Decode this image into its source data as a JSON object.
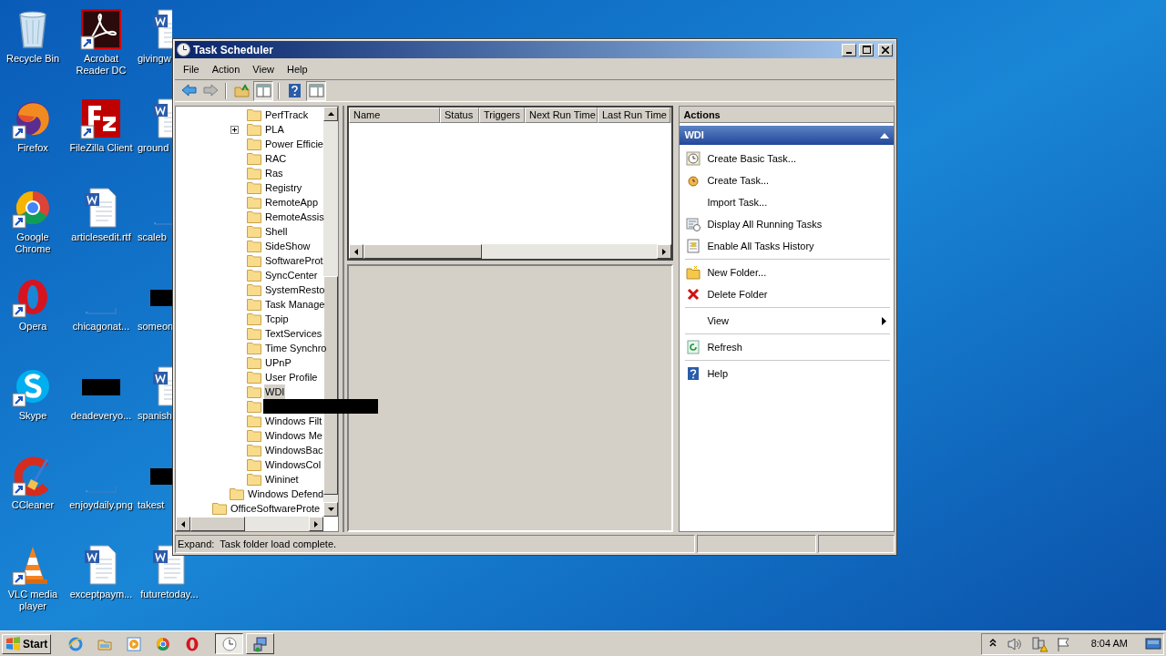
{
  "desktop": {
    "icons": [
      {
        "label": "Recycle Bin",
        "kind": "recycle",
        "shortcut": false
      },
      {
        "label": "Firefox",
        "kind": "firefox",
        "shortcut": true
      },
      {
        "label": "Google Chrome",
        "kind": "chrome",
        "shortcut": true
      },
      {
        "label": "Opera",
        "kind": "opera",
        "shortcut": true
      },
      {
        "label": "Skype",
        "kind": "skype",
        "shortcut": true
      },
      {
        "label": "CCleaner",
        "kind": "ccleaner",
        "shortcut": true
      },
      {
        "label": "VLC media player",
        "kind": "vlc",
        "shortcut": true
      },
      {
        "label": "Acrobat Reader DC",
        "kind": "acrobat",
        "shortcut": true
      },
      {
        "label": "FileZilla Client",
        "kind": "filezilla",
        "shortcut": true
      },
      {
        "label": "articlesedit.rtf",
        "kind": "word",
        "shortcut": false
      },
      {
        "label": "chicagonat...",
        "kind": "thumbnail",
        "shortcut": false
      },
      {
        "label": "deadeveryo...",
        "kind": "redacted",
        "shortcut": false
      },
      {
        "label": "enjoydaily.png",
        "kind": "thumbnail",
        "shortcut": false
      },
      {
        "label": "exceptpaym...",
        "kind": "word",
        "shortcut": false
      },
      {
        "label": "givingw",
        "kind": "word",
        "shortcut": false
      },
      {
        "label": "ground",
        "kind": "word",
        "shortcut": false
      },
      {
        "label": "scaleb",
        "kind": "thumbnail",
        "shortcut": false
      },
      {
        "label": "someon",
        "kind": "redacted",
        "shortcut": false
      },
      {
        "label": "spanish",
        "kind": "word",
        "shortcut": false
      },
      {
        "label": "takest",
        "kind": "redacted",
        "shortcut": false
      },
      {
        "label": "futuretoday...",
        "kind": "word",
        "shortcut": false
      }
    ]
  },
  "window": {
    "title": "Task Scheduler",
    "menu": [
      "File",
      "Action",
      "View",
      "Help"
    ],
    "toolbar": [
      {
        "kind": "back",
        "pressed": false
      },
      {
        "kind": "forward",
        "pressed": false
      },
      {
        "kind": "separator"
      },
      {
        "kind": "up-folder",
        "pressed": false
      },
      {
        "kind": "tree-pane",
        "pressed": true
      },
      {
        "kind": "separator"
      },
      {
        "kind": "help",
        "pressed": false
      },
      {
        "kind": "action-pane",
        "pressed": true
      }
    ],
    "tree": [
      {
        "children": [
          {
            "children": [
              {
                "label": "PerfTrack",
                "expandable": false,
                "selected": false
              },
              {
                "label": "PLA",
                "expandable": true,
                "selected": false
              },
              {
                "label": "Power Efficie",
                "expandable": false,
                "selected": false
              },
              {
                "label": "RAC",
                "expandable": false,
                "selected": false
              },
              {
                "label": "Ras",
                "expandable": false,
                "selected": false
              },
              {
                "label": "Registry",
                "expandable": false,
                "selected": false
              },
              {
                "label": "RemoteApp",
                "expandable": false,
                "selected": false
              },
              {
                "label": "RemoteAssis",
                "expandable": false,
                "selected": false
              },
              {
                "label": "Shell",
                "expandable": false,
                "selected": false
              },
              {
                "label": "SideShow",
                "expandable": false,
                "selected": false
              },
              {
                "label": "SoftwareProt",
                "expandable": false,
                "selected": false
              },
              {
                "label": "SyncCenter",
                "expandable": false,
                "selected": false
              },
              {
                "label": "SystemResto",
                "expandable": false,
                "selected": false
              },
              {
                "label": "Task Manage",
                "expandable": false,
                "selected": false
              },
              {
                "label": "Tcpip",
                "expandable": false,
                "selected": false
              },
              {
                "label": "TextServices",
                "expandable": false,
                "selected": false
              },
              {
                "label": "Time Synchro",
                "expandable": false,
                "selected": false
              },
              {
                "label": "UPnP",
                "expandable": false,
                "selected": false
              },
              {
                "label": "User Profile",
                "expandable": false,
                "selected": false
              },
              {
                "label": "WDI",
                "expandable": false,
                "selected": true
              },
              {
                "redacted": true,
                "expandable": false
              },
              {
                "label": "Windows Filt",
                "expandable": false,
                "selected": false
              },
              {
                "label": "Windows Me",
                "expandable": false,
                "selected": false
              },
              {
                "label": "WindowsBac",
                "expandable": false,
                "selected": false
              },
              {
                "label": "WindowsCol",
                "expandable": false,
                "selected": false
              },
              {
                "label": "Wininet",
                "expandable": false,
                "selected": false
              }
            ]
          },
          {
            "label": "Windows Defend",
            "expandable": false,
            "selected": false
          }
        ]
      },
      {
        "label": "OfficeSoftwareProte",
        "expandable": false,
        "selected": false
      }
    ],
    "table": {
      "columns": [
        "Name",
        "Status",
        "Triggers",
        "Next Run Time",
        "Last Run Time"
      ]
    },
    "actions": {
      "title": "Actions",
      "section": "WDI",
      "items": [
        {
          "label": "Create Basic Task...",
          "kind": "basic-task",
          "separator_above": false
        },
        {
          "label": "Create Task...",
          "kind": "task",
          "separator_above": false
        },
        {
          "label": "Import Task...",
          "kind": "none",
          "separator_above": false
        },
        {
          "label": "Display All Running Tasks",
          "kind": "running",
          "separator_above": false
        },
        {
          "label": "Enable All Tasks History",
          "kind": "history",
          "separator_above": false
        },
        {
          "label": "New Folder...",
          "kind": "folder",
          "separator_above": true
        },
        {
          "label": "Delete Folder",
          "kind": "delete",
          "separator_above": false
        },
        {
          "label": "View",
          "kind": "submenu",
          "separator_above": true
        },
        {
          "label": "Refresh",
          "kind": "refresh",
          "separator_above": true
        },
        {
          "label": "Help",
          "kind": "help",
          "separator_above": true
        }
      ]
    },
    "status_bar": "Expand:  Task folder load complete."
  },
  "taskbar": {
    "start": "Start",
    "quick_launch": [
      {
        "kind": "ie"
      },
      {
        "kind": "explorer"
      },
      {
        "kind": "media"
      },
      {
        "kind": "chrome"
      },
      {
        "kind": "opera"
      }
    ],
    "tasks": [
      {
        "kind": "clock",
        "selected": true
      },
      {
        "kind": "network-app",
        "selected": false
      }
    ],
    "tray": {
      "icons": [
        {
          "kind": "arrows"
        },
        {
          "kind": "speaker"
        },
        {
          "kind": "network"
        },
        {
          "kind": "flag"
        }
      ],
      "clock": "8:04 AM"
    }
  }
}
